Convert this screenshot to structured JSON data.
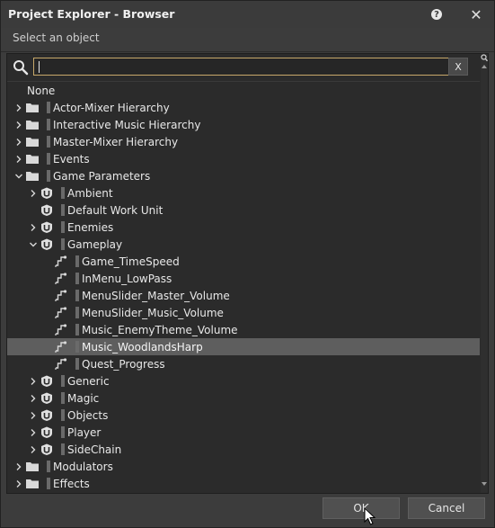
{
  "window": {
    "title": "Project Explorer - Browser",
    "subtitle": "Select an object",
    "help_icon": "help-icon",
    "close_icon": "close-icon"
  },
  "search": {
    "value": "",
    "clear_label": "X",
    "accent_color": "#c7a86a"
  },
  "tree": {
    "none_label": "None",
    "items": [
      {
        "label": "Actor-Mixer Hierarchy",
        "level": 0,
        "icon": "folder-icon",
        "expander": "collapsed"
      },
      {
        "label": "Interactive Music Hierarchy",
        "level": 0,
        "icon": "folder-icon",
        "expander": "collapsed"
      },
      {
        "label": "Master-Mixer Hierarchy",
        "level": 0,
        "icon": "folder-icon",
        "expander": "collapsed"
      },
      {
        "label": "Events",
        "level": 0,
        "icon": "folder-icon",
        "expander": "collapsed"
      },
      {
        "label": "Game Parameters",
        "level": 0,
        "icon": "folder-icon",
        "expander": "expanded"
      },
      {
        "label": "Ambient",
        "level": 1,
        "icon": "work-unit-icon",
        "expander": "collapsed"
      },
      {
        "label": "Default Work Unit",
        "level": 1,
        "icon": "work-unit-icon",
        "expander": "none"
      },
      {
        "label": "Enemies",
        "level": 1,
        "icon": "work-unit-icon",
        "expander": "collapsed"
      },
      {
        "label": "Gameplay",
        "level": 1,
        "icon": "work-unit-icon",
        "expander": "expanded"
      },
      {
        "label": "Game_TimeSpeed",
        "level": 2,
        "icon": "game-parameter-icon",
        "expander": "none"
      },
      {
        "label": "InMenu_LowPass",
        "level": 2,
        "icon": "game-parameter-icon",
        "expander": "none"
      },
      {
        "label": "MenuSlider_Master_Volume",
        "level": 2,
        "icon": "game-parameter-icon",
        "expander": "none"
      },
      {
        "label": "MenuSlider_Music_Volume",
        "level": 2,
        "icon": "game-parameter-icon",
        "expander": "none"
      },
      {
        "label": "Music_EnemyTheme_Volume",
        "level": 2,
        "icon": "game-parameter-icon",
        "expander": "none"
      },
      {
        "label": "Music_WoodlandsHarp",
        "level": 2,
        "icon": "game-parameter-icon",
        "expander": "none",
        "selected": true
      },
      {
        "label": "Quest_Progress",
        "level": 2,
        "icon": "game-parameter-icon",
        "expander": "none"
      },
      {
        "label": "Generic",
        "level": 1,
        "icon": "work-unit-icon",
        "expander": "collapsed"
      },
      {
        "label": "Magic",
        "level": 1,
        "icon": "work-unit-icon",
        "expander": "collapsed"
      },
      {
        "label": "Objects",
        "level": 1,
        "icon": "work-unit-icon",
        "expander": "collapsed"
      },
      {
        "label": "Player",
        "level": 1,
        "icon": "work-unit-icon",
        "expander": "collapsed"
      },
      {
        "label": "SideChain",
        "level": 1,
        "icon": "work-unit-icon",
        "expander": "collapsed"
      },
      {
        "label": "Modulators",
        "level": 0,
        "icon": "folder-icon",
        "expander": "collapsed"
      },
      {
        "label": "Effects",
        "level": 0,
        "icon": "folder-icon",
        "expander": "collapsed"
      }
    ]
  },
  "buttons": {
    "ok_label": "OK",
    "cancel_label": "Cancel"
  }
}
